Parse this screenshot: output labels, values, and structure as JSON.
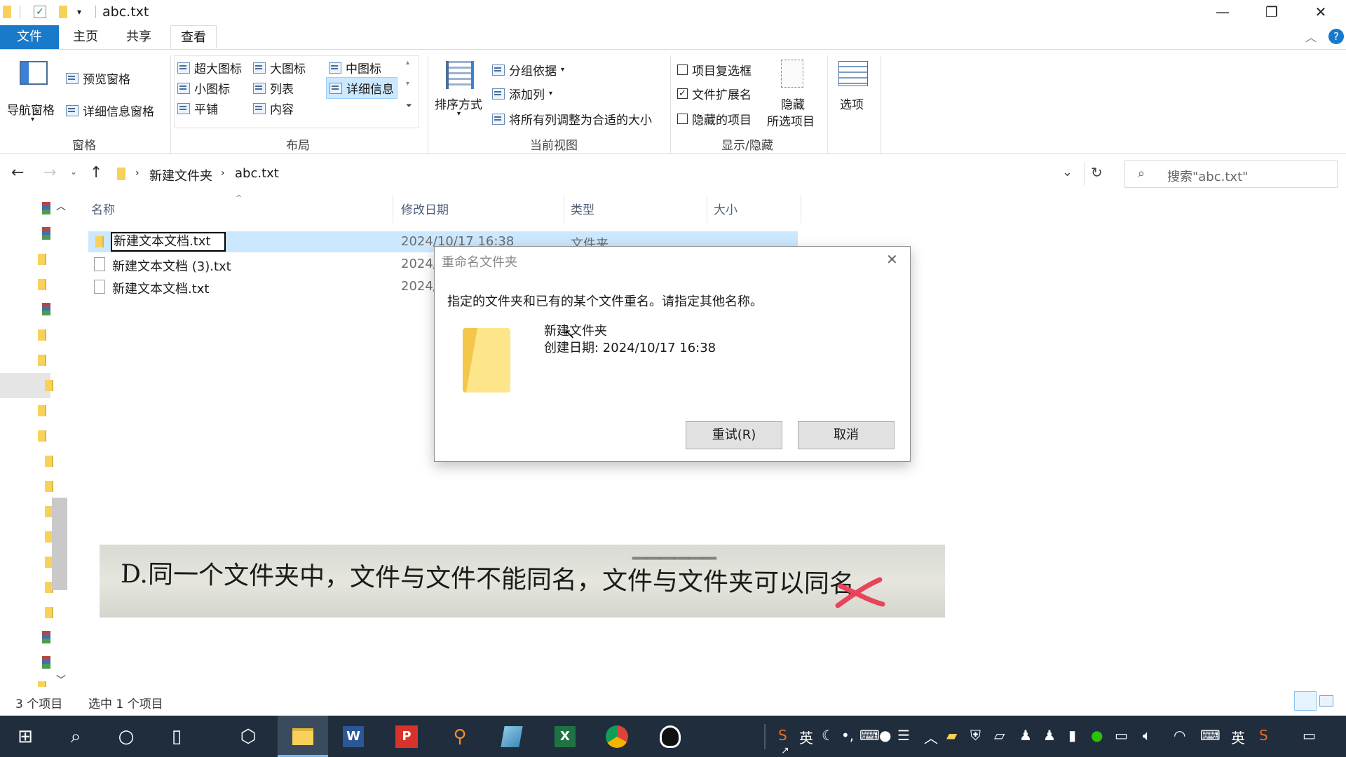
{
  "window": {
    "title": "abc.txt",
    "controls": {
      "minimize": "—",
      "restore": "❐",
      "close": "✕"
    }
  },
  "ribbon_tabs": [
    "文件",
    "主页",
    "共享",
    "查看"
  ],
  "ribbon": {
    "panes": {
      "nav_pane": "导航窗格",
      "preview_pane": "预览窗格",
      "details_pane": "详细信息窗格",
      "label": "窗格"
    },
    "layout": {
      "items": [
        "超大图标",
        "大图标",
        "中图标",
        "小图标",
        "列表",
        "详细信息",
        "平铺",
        "内容"
      ],
      "selected": "详细信息",
      "label": "布局"
    },
    "current_view": {
      "sort": "排序方式",
      "group_by": "分组依据",
      "add_column": "添加列",
      "fit_columns": "将所有列调整为合适的大小",
      "label": "当前视图"
    },
    "show_hide": {
      "item_checkboxes": "项目复选框",
      "file_extensions": "文件扩展名",
      "hidden_items": "隐藏的项目",
      "hide_selected_1": "隐藏",
      "hide_selected_2": "所选项目",
      "label": "显示/隐藏"
    },
    "options": "选项"
  },
  "address": {
    "crumbs": [
      "新建文件夹",
      "abc.txt"
    ],
    "search_placeholder": "搜索\"abc.txt\""
  },
  "columns": [
    "名称",
    "修改日期",
    "类型",
    "大小"
  ],
  "files": [
    {
      "name": "新建文本文档.txt",
      "date": "2024/10/17 16:38",
      "type": "文件夹",
      "editing": true,
      "selected": true,
      "kind": "folder"
    },
    {
      "name": "新建文本文档 (3).txt",
      "date": "2024/",
      "type": "",
      "kind": "file"
    },
    {
      "name": "新建文本文档.txt",
      "date": "2024/",
      "type": "",
      "kind": "file"
    }
  ],
  "dialog": {
    "title": "重命名文件夹",
    "message": "指定的文件夹和已有的某个文件重名。请指定其他名称。",
    "item_name": "新建文件夹",
    "item_created": "创建日期: 2024/10/17 16:38",
    "retry": "重试(R)",
    "cancel": "取消"
  },
  "overlay_photo": {
    "text": "D.同一个文件夹中，文件与文件不能同名，文件与文件夹可以同名"
  },
  "status": {
    "count": "3 个项目",
    "selected": "选中 1 个项目"
  },
  "taskbar": {
    "tray": {
      "ime1": "英",
      "ime2": "英"
    }
  },
  "colors": {
    "accent": "#1979ca",
    "selected_row": "#cce8ff",
    "taskbar": "#1f2d3d",
    "red_mark": "#e8445a"
  }
}
